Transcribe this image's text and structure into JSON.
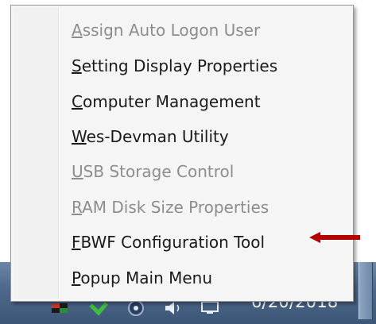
{
  "menu": {
    "items": [
      {
        "accel": "A",
        "rest": "ssign Auto Logon User",
        "disabled": true
      },
      {
        "accel": "S",
        "rest": "etting Display Properties",
        "disabled": false
      },
      {
        "accel": "C",
        "rest": "omputer Management",
        "disabled": false
      },
      {
        "accel": "W",
        "rest": "es-Devman Utility",
        "disabled": false
      },
      {
        "accel": "U",
        "rest": "SB Storage Control",
        "disabled": true
      },
      {
        "accel": "R",
        "rest": "AM Disk Size Properties",
        "disabled": true
      },
      {
        "accel": "F",
        "rest": "BWF Configuration Tool",
        "disabled": false
      },
      {
        "accel": "P",
        "rest": "opup Main Menu",
        "disabled": false
      }
    ]
  },
  "taskbar": {
    "clock_date": "6/20/2018",
    "tray_icons": [
      "flag-icon",
      "update-icon",
      "network-icon",
      "volume-icon",
      "display-icon"
    ]
  },
  "annotation": {
    "arrow_color": "#b30000"
  }
}
